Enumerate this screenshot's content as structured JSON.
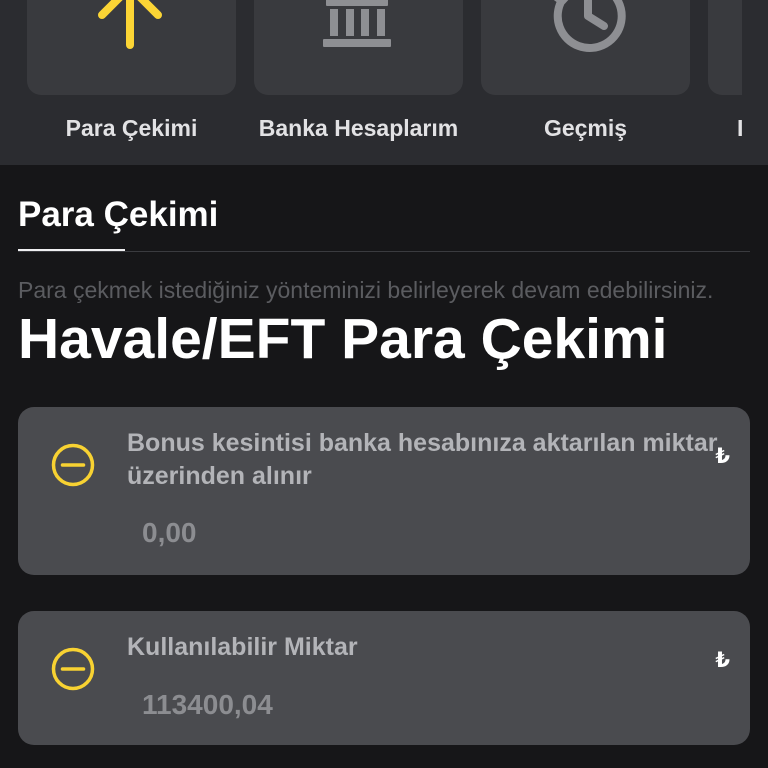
{
  "quick_actions": [
    {
      "label": "Para Çekimi",
      "icon": "arrow-up-icon"
    },
    {
      "label": "Banka Hesaplarım",
      "icon": "bank-icon"
    },
    {
      "label": "Geçmiş",
      "icon": "history-icon"
    },
    {
      "label": "I"
    }
  ],
  "tab": {
    "label": "Para Çekimi"
  },
  "instructions": "Para çekmek istediğiniz yönteminizi belirleyerek devam edebilirsiniz.",
  "method": {
    "title": "Havale/EFT Para Çekimi",
    "fields": [
      {
        "icon": "minus-circle-icon",
        "label": "Bonus kesintisi banka hesabınıza aktarılan miktar üzerinden alınır",
        "currency": "₺",
        "value": "0,00"
      },
      {
        "icon": "minus-circle-icon",
        "label": "Kullanılabilir Miktar",
        "currency": "₺",
        "value": "113400,04"
      }
    ]
  },
  "colors": {
    "accent": "#fcd535",
    "background": "#161618",
    "header_band": "#2b2c30",
    "tile": "#393a3e",
    "card": "#4a4b4f",
    "muted_icon": "#8e8f93"
  }
}
